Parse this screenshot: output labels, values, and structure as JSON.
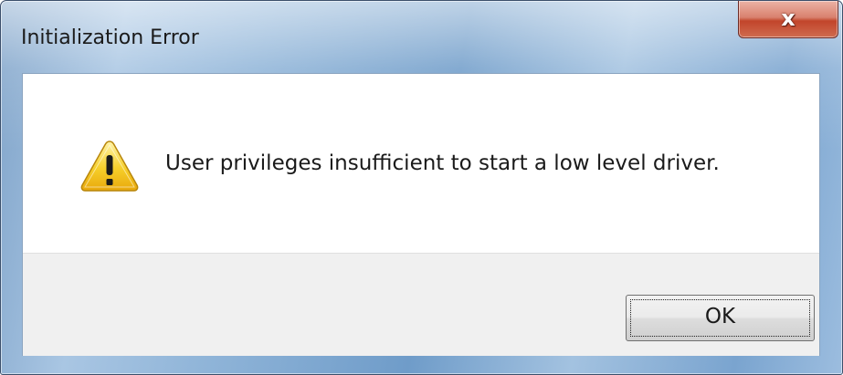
{
  "window": {
    "title": "Initialization Error"
  },
  "titlebar": {
    "close_icon": "close-icon",
    "close_glyph": "x"
  },
  "dialog": {
    "icon": "warning-icon",
    "message": "User privileges insufficient to start a low level driver."
  },
  "buttons": {
    "ok_label": "OK"
  },
  "colors": {
    "close_button": "#c2452b",
    "warning_fill": "#f5c518",
    "button_area": "#f0f0f0"
  }
}
